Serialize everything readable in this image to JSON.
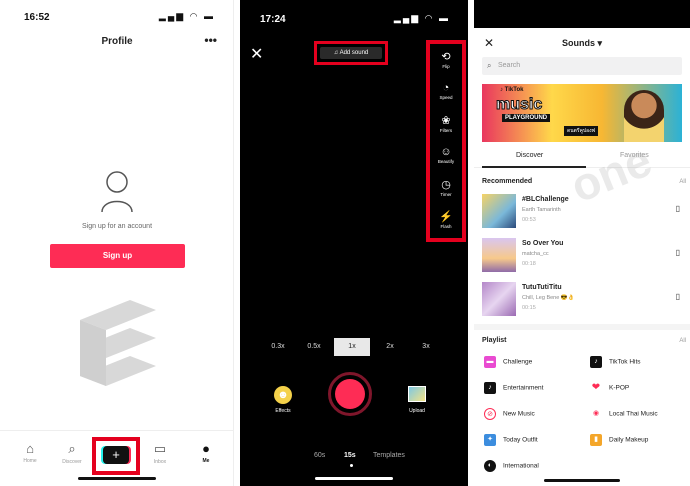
{
  "left": {
    "time": "16:52",
    "title": "Profile",
    "more": "•••",
    "signup_prompt": "Sign up for an account",
    "signup_button": "Sign up",
    "tabs": [
      {
        "label": "Home",
        "icon": "⌂"
      },
      {
        "label": "Discover",
        "icon": "⌕"
      },
      {
        "label": "",
        "icon": "+"
      },
      {
        "label": "Inbox",
        "icon": "▭"
      },
      {
        "label": "Me",
        "icon": "●"
      }
    ]
  },
  "camera": {
    "time": "17:24",
    "add_sound": "♫ Add sound",
    "tools": [
      {
        "label": "Flip",
        "icon": "⟲"
      },
      {
        "label": "Speed",
        "icon": "◔"
      },
      {
        "label": "Filters",
        "icon": "❀"
      },
      {
        "label": "Beautify",
        "icon": "☺"
      },
      {
        "label": "Timer",
        "icon": "◷"
      },
      {
        "label": "Flash",
        "icon": "⚡"
      }
    ],
    "speeds": [
      "0.3x",
      "0.5x",
      "1x",
      "2x",
      "3x"
    ],
    "active_speed": "1x",
    "effects_label": "Effects",
    "upload_label": "Upload",
    "modes": [
      "60s",
      "15s",
      "Templates"
    ],
    "active_mode": "15s"
  },
  "sounds": {
    "title": "Sounds ▾",
    "search_placeholder": "Search",
    "banner": {
      "logo": "♪ TikTok",
      "music": "music",
      "playground": "PLAYGROUND",
      "thai": "ดนตรีคูปองฟ"
    },
    "tabs": [
      "Discover",
      "Favorites"
    ],
    "recommended_title": "Recommended",
    "all_label": "All",
    "songs": [
      {
        "name": "#BLChallenge",
        "artist": "Earth  Tamarinth",
        "duration": "00:53"
      },
      {
        "name": "So Over You",
        "artist": "matcha_cc",
        "duration": "00:18"
      },
      {
        "name": "TutuTutiTitu",
        "artist": "Chill, Leg Bene 😎👌",
        "duration": "00:15"
      }
    ],
    "playlist_title": "Playlist",
    "playlists": [
      {
        "label": "Challenge",
        "color": "#e94bd1"
      },
      {
        "label": "TikTok Hits",
        "color": "#111111"
      },
      {
        "label": "Entertainment",
        "color": "#111111"
      },
      {
        "label": "K-POP",
        "color": "#fe2c55"
      },
      {
        "label": "New Music",
        "color": "#fe2c55"
      },
      {
        "label": "Local Thai Music",
        "color": "#fe2c55"
      },
      {
        "label": "Today Outfit",
        "color": "#3c8dde"
      },
      {
        "label": "Daily Makeup",
        "color": "#f4a62a"
      },
      {
        "label": "International",
        "color": "#111111"
      }
    ]
  }
}
